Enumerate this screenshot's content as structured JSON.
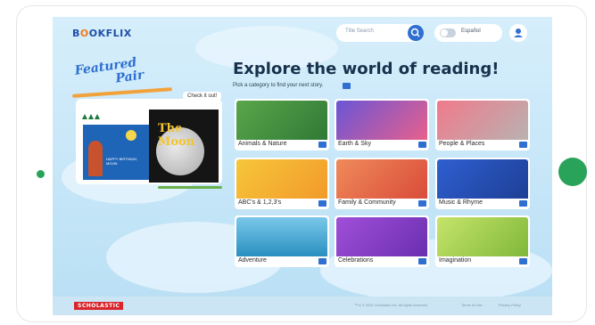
{
  "header": {
    "logo": {
      "part1": "B",
      "part2": "O",
      "part3": "OKFLIX"
    },
    "search": {
      "placeholder": "Title Search",
      "icon": "search-icon"
    },
    "language": {
      "label": "Español"
    },
    "profile": {
      "icon": "user-icon"
    }
  },
  "featured": {
    "title_line1": "Featured",
    "title_line2": "Pair",
    "badge": "Check it out!",
    "book1": {
      "text": "HAPPY BIRTHDAY, MOON"
    },
    "book2": {
      "title": "The Moon"
    }
  },
  "main": {
    "title": "Explore the world of reading!",
    "subtitle": "Pick a category to find your next story."
  },
  "categories": [
    {
      "label": "Animals & Nature",
      "color": "#3b8a3e"
    },
    {
      "label": "Earth & Sky",
      "color": "#5b3fb0"
    },
    {
      "label": "People & Places",
      "color": "#e0506a"
    },
    {
      "label": "ABC's & 1,2,3's",
      "color": "#f2b531"
    },
    {
      "label": "Family & Community",
      "color": "#e36b3d"
    },
    {
      "label": "Music & Rhyme",
      "color": "#2a4fb8"
    },
    {
      "label": "Adventure",
      "color": "#2aa3c8"
    },
    {
      "label": "Celebrations",
      "color": "#8a3fc4"
    },
    {
      "label": "Imagination",
      "color": "#a7cf4f"
    }
  ],
  "footer": {
    "brand": "SCHOLASTIC",
    "copyright": "™ & © 2021 Scholastic Inc. All rights reserved.",
    "terms": "Terms of Use",
    "privacy": "Privacy Policy"
  }
}
